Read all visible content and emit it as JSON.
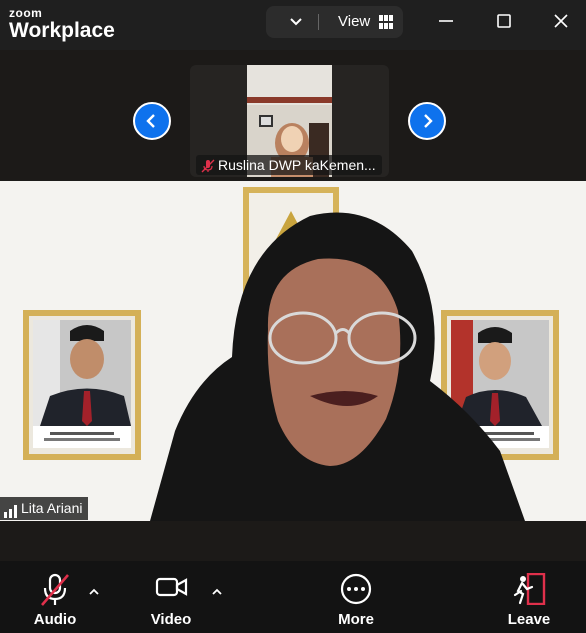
{
  "app": {
    "logo_small": "zoom",
    "logo_big": "Workplace"
  },
  "view_control": {
    "label": "View"
  },
  "thumbnail": {
    "name": "Ruslina DWP kaKemen..."
  },
  "speaker": {
    "name": "Lita Ariani",
    "portrait_left_caption": "H. Prabowo Subianto\nPresiden Republik Indonesia",
    "portrait_right_caption": "Gibran Rakabuming Raka\nWakil Presiden Republik Indonesia"
  },
  "toolbar": {
    "audio_label": "Audio",
    "video_label": "Video",
    "more_label": "More",
    "leave_label": "Leave"
  },
  "colors": {
    "accent": "#0e72ed",
    "danger": "#e0304b",
    "toolbar_bg": "#131313"
  }
}
